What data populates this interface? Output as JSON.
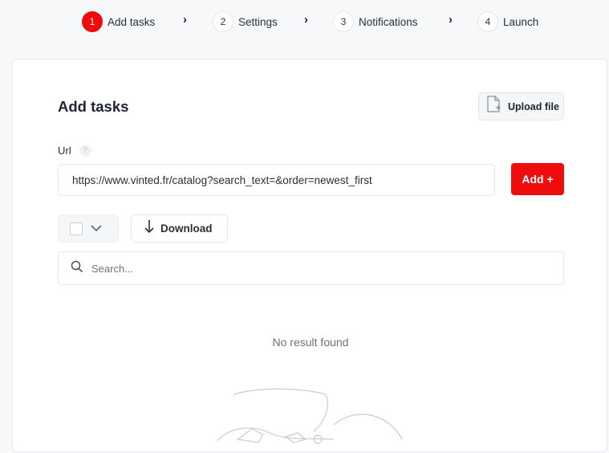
{
  "stepper": {
    "steps": [
      {
        "num": "1",
        "label": "Add tasks",
        "active": true
      },
      {
        "num": "2",
        "label": "Settings",
        "active": false
      },
      {
        "num": "3",
        "label": "Notifications",
        "active": false
      },
      {
        "num": "4",
        "label": "Launch",
        "active": false
      }
    ],
    "separator_icon": "chevron-right-icon"
  },
  "card": {
    "title": "Add tasks",
    "upload_button": {
      "label": "Upload file",
      "icon": "file-add-icon"
    },
    "url_field": {
      "label": "Url",
      "help_icon": "?",
      "value": "https://www.vinted.fr/catalog?search_text=&order=newest_first"
    },
    "add_button": {
      "label": "Add +"
    },
    "toolbar": {
      "select_all_icon": "checkbox-icon",
      "dropdown_icon": "chevron-down-icon",
      "download_button": {
        "label": "Download",
        "icon": "arrow-down-icon"
      }
    },
    "search": {
      "placeholder": "Search...",
      "icon": "search-icon"
    },
    "empty_state": {
      "message": "No result found"
    }
  },
  "colors": {
    "accent": "#ee0c0c",
    "background": "#f7f8fa",
    "card": "#ffffff",
    "border": "#e3e5e9"
  }
}
